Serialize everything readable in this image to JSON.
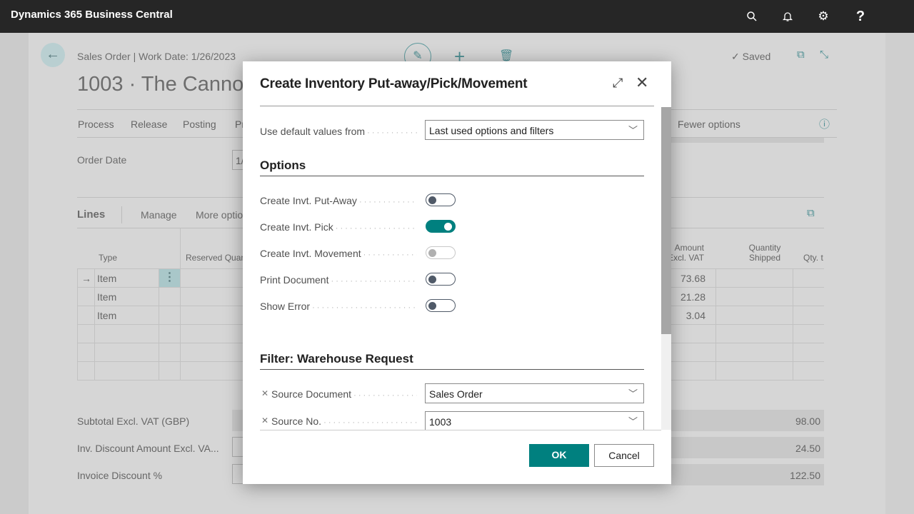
{
  "app": {
    "title": "Dynamics 365 Business Central",
    "icons": [
      "search-icon",
      "bell-icon",
      "gear-icon",
      "help-icon"
    ]
  },
  "page": {
    "breadcrumb": "Sales Order | Work Date: 1/26/2023",
    "title": "1003 · The Cannon",
    "saved": "Saved",
    "menu": [
      "Process",
      "Release",
      "Posting",
      "Pr"
    ],
    "fewer_options": "Fewer options",
    "order_date_label": "Order Date",
    "order_date_value": "1/",
    "lines": {
      "title": "Lines",
      "manage": "Manage",
      "more": "More optio",
      "headers": {
        "type": "Type",
        "reserved": "Reserved Quan",
        "amount": "Amount Excl. VAT",
        "qty_shipped": "Quantity Shipped",
        "qty_to": "Qty. t"
      },
      "rows": [
        {
          "type": "Item",
          "amount": "73.68"
        },
        {
          "type": "Item",
          "amount": "21.28"
        },
        {
          "type": "Item",
          "amount": "3.04"
        }
      ]
    },
    "totals": [
      {
        "label": "Subtotal Excl. VAT (GBP)",
        "value": "98.00"
      },
      {
        "label": "Inv. Discount Amount Excl. VA...",
        "value": "24.50"
      },
      {
        "label": "Invoice Discount %",
        "value": "122.50"
      }
    ]
  },
  "dialog": {
    "title": "Create Inventory Put-away/Pick/Movement",
    "default_label": "Use default values from",
    "default_value": "Last used options and filters",
    "options_title": "Options",
    "options": [
      {
        "label": "Create Invt. Put-Away",
        "state": "off"
      },
      {
        "label": "Create Invt. Pick",
        "state": "on"
      },
      {
        "label": "Create Invt. Movement",
        "state": "disabled"
      },
      {
        "label": "Print Document",
        "state": "off"
      },
      {
        "label": "Show Error",
        "state": "off"
      }
    ],
    "filter_title": "Filter: Warehouse Request",
    "filters": [
      {
        "label": "Source Document",
        "value": "Sales Order"
      },
      {
        "label": "Source No.",
        "value": "1003"
      }
    ],
    "ok": "OK",
    "cancel": "Cancel"
  },
  "colors": {
    "accent": "#00807f",
    "topbar": "#262626"
  }
}
